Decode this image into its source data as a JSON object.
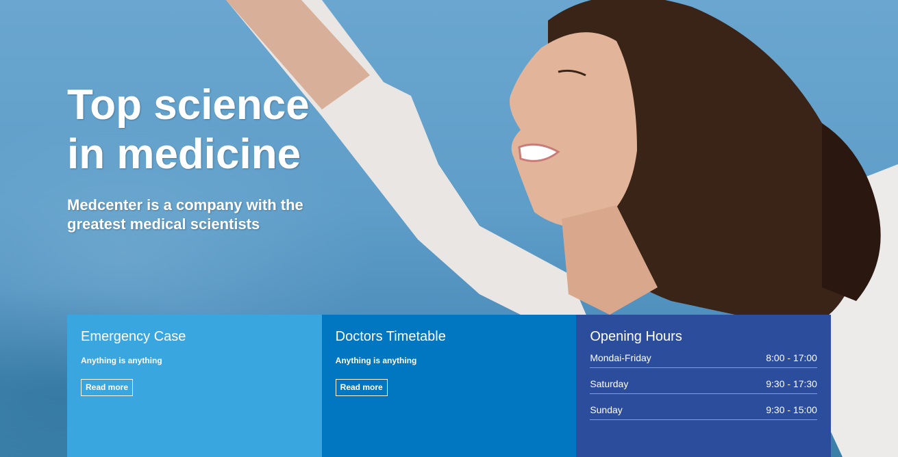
{
  "hero": {
    "title": "Top science in medicine",
    "subtitle": "Medcenter is a company with the greatest medical scientists"
  },
  "panels": {
    "emergency": {
      "title": "Emergency Case",
      "text": "Anything is anything",
      "button": "Read more"
    },
    "doctors": {
      "title": "Doctors Timetable",
      "text": "Anything is anything",
      "button": "Read more"
    },
    "hours": {
      "title": "Opening Hours",
      "rows": [
        {
          "day": "Mondai-Friday",
          "time": "8:00 - 17:00"
        },
        {
          "day": "Saturday",
          "time": "9:30 - 17:30"
        },
        {
          "day": "Sunday",
          "time": "9:30 - 15:00"
        }
      ]
    }
  },
  "colors": {
    "emergency": "#3aa6e0",
    "doctors": "#0077c0",
    "hours": "#2c4d9c"
  }
}
